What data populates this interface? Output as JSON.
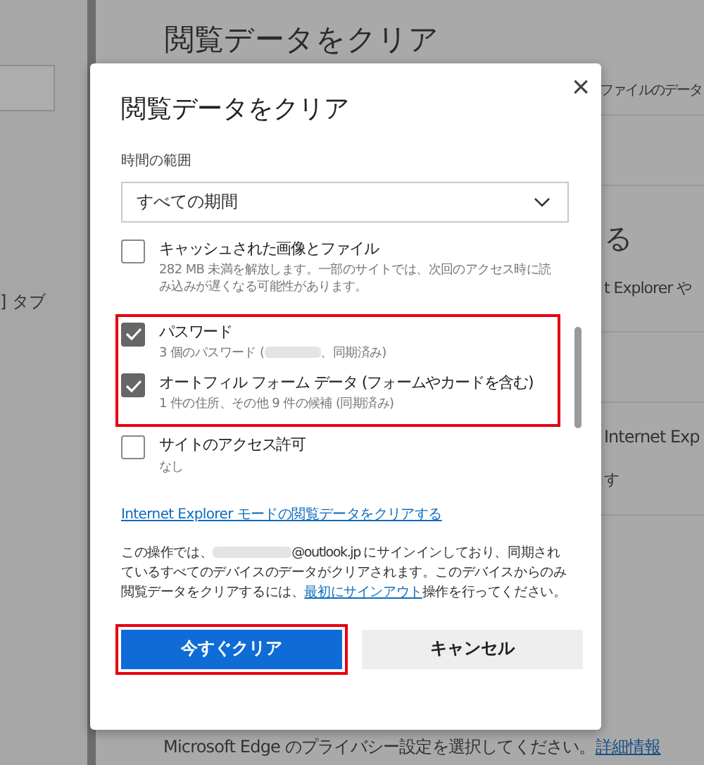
{
  "background": {
    "heading": "閲覧データをクリア",
    "sidebar_text": "] タブ",
    "right_texts": [
      "ファイルのデータ",
      "る",
      "t Explorer や",
      "Internet Exp",
      "す"
    ],
    "footer": {
      "text": "Microsoft Edge のプライバシー設定を選択してください。",
      "link": "詳細情報"
    }
  },
  "dialog": {
    "title": "閲覧データをクリア",
    "close": "×",
    "time_range": {
      "label": "時間の範囲",
      "value": "すべての期間"
    },
    "items": [
      {
        "label": "キャッシュされた画像とファイル",
        "detail": "282 MB 未満を解放します。一部のサイトでは、次回のアクセス時に読み込みが遅くなる可能性があります。",
        "checked": false,
        "highlighted": false
      },
      {
        "label": "パスワード",
        "detail": "3 個のパスワード (",
        "detail_redacted": true,
        "detail_after": "、同期済み)",
        "checked": true,
        "highlighted": true
      },
      {
        "label": "オートフィル フォーム データ (フォームやカードを含む)",
        "detail": "1 件の住所、その他 9 件の候補 (同期済み)",
        "checked": true,
        "highlighted": true
      },
      {
        "label": "サイトのアクセス許可",
        "detail": "なし",
        "checked": false,
        "highlighted": false
      }
    ],
    "ie_link": "Internet Explorer モードの閲覧データをクリアする",
    "notice": {
      "before": "この操作では、",
      "after": "@outlook.jp にサインインしており、同期されているすべてのデバイスのデータがクリアされます。このデバイスからのみ閲覧データをクリアするには、",
      "link": "最初にサインアウト",
      "end": "操作を行ってください。"
    },
    "buttons": [
      {
        "label": "今すぐクリア",
        "kind": "primary",
        "highlighted": true
      },
      {
        "label": "キャンセル",
        "kind": "secondary",
        "highlighted": false
      }
    ]
  }
}
